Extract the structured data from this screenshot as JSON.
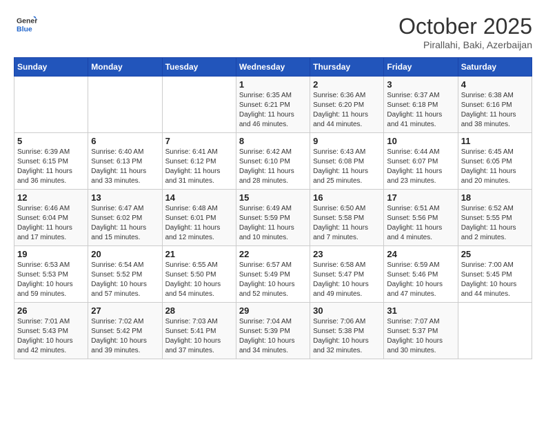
{
  "header": {
    "logo_line1": "General",
    "logo_line2": "Blue",
    "month": "October 2025",
    "location": "Pirallahi, Baki, Azerbaijan"
  },
  "days_of_week": [
    "Sunday",
    "Monday",
    "Tuesday",
    "Wednesday",
    "Thursday",
    "Friday",
    "Saturday"
  ],
  "weeks": [
    [
      {
        "num": "",
        "info": ""
      },
      {
        "num": "",
        "info": ""
      },
      {
        "num": "",
        "info": ""
      },
      {
        "num": "1",
        "info": "Sunrise: 6:35 AM\nSunset: 6:21 PM\nDaylight: 11 hours and 46 minutes."
      },
      {
        "num": "2",
        "info": "Sunrise: 6:36 AM\nSunset: 6:20 PM\nDaylight: 11 hours and 44 minutes."
      },
      {
        "num": "3",
        "info": "Sunrise: 6:37 AM\nSunset: 6:18 PM\nDaylight: 11 hours and 41 minutes."
      },
      {
        "num": "4",
        "info": "Sunrise: 6:38 AM\nSunset: 6:16 PM\nDaylight: 11 hours and 38 minutes."
      }
    ],
    [
      {
        "num": "5",
        "info": "Sunrise: 6:39 AM\nSunset: 6:15 PM\nDaylight: 11 hours and 36 minutes."
      },
      {
        "num": "6",
        "info": "Sunrise: 6:40 AM\nSunset: 6:13 PM\nDaylight: 11 hours and 33 minutes."
      },
      {
        "num": "7",
        "info": "Sunrise: 6:41 AM\nSunset: 6:12 PM\nDaylight: 11 hours and 31 minutes."
      },
      {
        "num": "8",
        "info": "Sunrise: 6:42 AM\nSunset: 6:10 PM\nDaylight: 11 hours and 28 minutes."
      },
      {
        "num": "9",
        "info": "Sunrise: 6:43 AM\nSunset: 6:08 PM\nDaylight: 11 hours and 25 minutes."
      },
      {
        "num": "10",
        "info": "Sunrise: 6:44 AM\nSunset: 6:07 PM\nDaylight: 11 hours and 23 minutes."
      },
      {
        "num": "11",
        "info": "Sunrise: 6:45 AM\nSunset: 6:05 PM\nDaylight: 11 hours and 20 minutes."
      }
    ],
    [
      {
        "num": "12",
        "info": "Sunrise: 6:46 AM\nSunset: 6:04 PM\nDaylight: 11 hours and 17 minutes."
      },
      {
        "num": "13",
        "info": "Sunrise: 6:47 AM\nSunset: 6:02 PM\nDaylight: 11 hours and 15 minutes."
      },
      {
        "num": "14",
        "info": "Sunrise: 6:48 AM\nSunset: 6:01 PM\nDaylight: 11 hours and 12 minutes."
      },
      {
        "num": "15",
        "info": "Sunrise: 6:49 AM\nSunset: 5:59 PM\nDaylight: 11 hours and 10 minutes."
      },
      {
        "num": "16",
        "info": "Sunrise: 6:50 AM\nSunset: 5:58 PM\nDaylight: 11 hours and 7 minutes."
      },
      {
        "num": "17",
        "info": "Sunrise: 6:51 AM\nSunset: 5:56 PM\nDaylight: 11 hours and 4 minutes."
      },
      {
        "num": "18",
        "info": "Sunrise: 6:52 AM\nSunset: 5:55 PM\nDaylight: 11 hours and 2 minutes."
      }
    ],
    [
      {
        "num": "19",
        "info": "Sunrise: 6:53 AM\nSunset: 5:53 PM\nDaylight: 10 hours and 59 minutes."
      },
      {
        "num": "20",
        "info": "Sunrise: 6:54 AM\nSunset: 5:52 PM\nDaylight: 10 hours and 57 minutes."
      },
      {
        "num": "21",
        "info": "Sunrise: 6:55 AM\nSunset: 5:50 PM\nDaylight: 10 hours and 54 minutes."
      },
      {
        "num": "22",
        "info": "Sunrise: 6:57 AM\nSunset: 5:49 PM\nDaylight: 10 hours and 52 minutes."
      },
      {
        "num": "23",
        "info": "Sunrise: 6:58 AM\nSunset: 5:47 PM\nDaylight: 10 hours and 49 minutes."
      },
      {
        "num": "24",
        "info": "Sunrise: 6:59 AM\nSunset: 5:46 PM\nDaylight: 10 hours and 47 minutes."
      },
      {
        "num": "25",
        "info": "Sunrise: 7:00 AM\nSunset: 5:45 PM\nDaylight: 10 hours and 44 minutes."
      }
    ],
    [
      {
        "num": "26",
        "info": "Sunrise: 7:01 AM\nSunset: 5:43 PM\nDaylight: 10 hours and 42 minutes."
      },
      {
        "num": "27",
        "info": "Sunrise: 7:02 AM\nSunset: 5:42 PM\nDaylight: 10 hours and 39 minutes."
      },
      {
        "num": "28",
        "info": "Sunrise: 7:03 AM\nSunset: 5:41 PM\nDaylight: 10 hours and 37 minutes."
      },
      {
        "num": "29",
        "info": "Sunrise: 7:04 AM\nSunset: 5:39 PM\nDaylight: 10 hours and 34 minutes."
      },
      {
        "num": "30",
        "info": "Sunrise: 7:06 AM\nSunset: 5:38 PM\nDaylight: 10 hours and 32 minutes."
      },
      {
        "num": "31",
        "info": "Sunrise: 7:07 AM\nSunset: 5:37 PM\nDaylight: 10 hours and 30 minutes."
      },
      {
        "num": "",
        "info": ""
      }
    ]
  ]
}
